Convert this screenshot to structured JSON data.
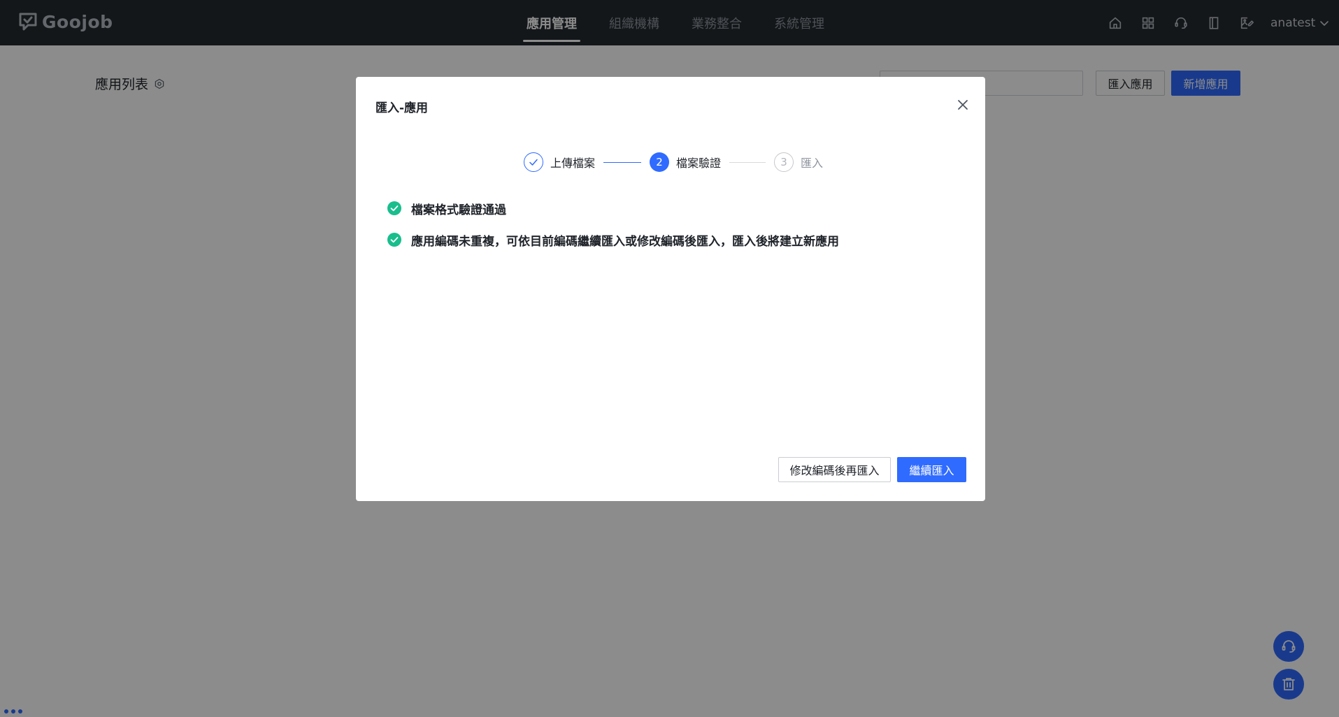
{
  "app": {
    "logo_text": "Goojob"
  },
  "nav": {
    "items": [
      "應用管理",
      "組織機構",
      "業務整合",
      "系統管理"
    ],
    "active_index": 0
  },
  "header_icons": [
    "home-icon",
    "apps-grid-icon",
    "support-headset-icon",
    "book-icon",
    "image-edit-icon"
  ],
  "user": {
    "name": "anatest"
  },
  "page": {
    "title": "應用列表",
    "search_placeholder": "",
    "import_button": "匯入應用",
    "new_button": "新增應用"
  },
  "modal": {
    "title": "匯入-應用",
    "steps": [
      {
        "number": "1",
        "label": "上傳檔案",
        "status": "done"
      },
      {
        "number": "2",
        "label": "檔案驗證",
        "status": "current"
      },
      {
        "number": "3",
        "label": "匯入",
        "status": "pending"
      }
    ],
    "checks": [
      "檔案格式驗證通過",
      "應用編碼未重複，可依目前編碼繼續匯入或修改編碼後匯入，匯入後將建立新應用"
    ],
    "secondary_button": "修改編碼後再匯入",
    "primary_button": "繼續匯入"
  },
  "colors": {
    "primary": "#2f6bff",
    "success": "#19be8c",
    "topbar": "#252a31"
  }
}
